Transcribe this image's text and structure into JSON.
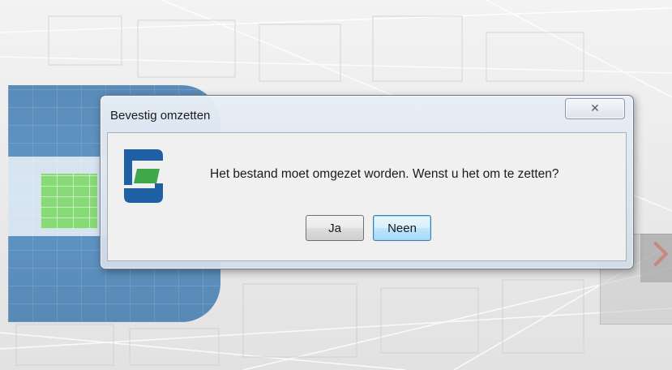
{
  "dialog": {
    "title": "Bevestig omzetten",
    "close_icon": "close-icon",
    "app_icon": "app-logo-icon",
    "message": "Het bestand moet omgezet worden. Wenst u het om te zetten?",
    "buttons": {
      "yes_label": "Ja",
      "no_label": "Neen",
      "default": "no"
    }
  },
  "colors": {
    "logo_blue": "#1f5fa3",
    "logo_green": "#3ea84a",
    "default_button_border": "#3c7fb1",
    "splash_blue": "#2f6fa8",
    "splash_green": "#7fd86a"
  }
}
